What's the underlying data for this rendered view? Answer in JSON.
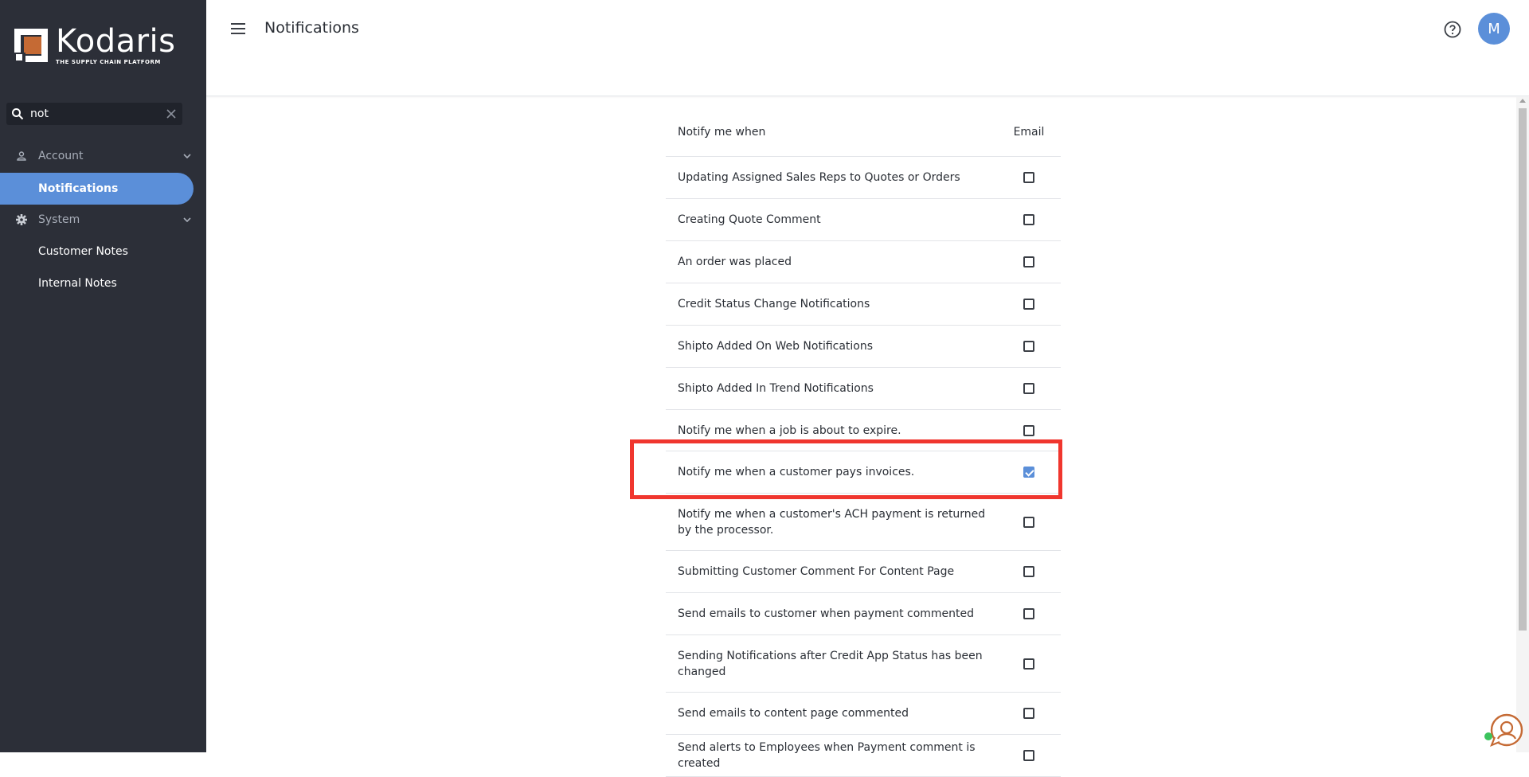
{
  "brand": {
    "name": "Kodaris",
    "tagline": "THE SUPPLY CHAIN PLATFORM",
    "accent": "#c56a34"
  },
  "search": {
    "value": "not",
    "placeholder": ""
  },
  "sidebar": {
    "groups": [
      {
        "label": "Account",
        "icon": "person-icon",
        "items": [
          {
            "label": "Notifications",
            "active": true
          }
        ]
      },
      {
        "label": "System",
        "icon": "gear-icon",
        "items": [
          {
            "label": "Customer Notes"
          },
          {
            "label": "Internal Notes"
          }
        ]
      }
    ]
  },
  "header": {
    "title": "Notifications",
    "avatar_initial": "M"
  },
  "table": {
    "col_event": "Notify me when",
    "col_email": "Email",
    "rows": [
      {
        "label": "Updating Assigned Sales Reps to Quotes or Orders",
        "email": false
      },
      {
        "label": "Creating Quote Comment",
        "email": false
      },
      {
        "label": "An order was placed",
        "email": false
      },
      {
        "label": "Credit Status Change Notifications",
        "email": false
      },
      {
        "label": "Shipto Added On Web Notifications",
        "email": false
      },
      {
        "label": "Shipto Added In Trend Notifications",
        "email": false
      },
      {
        "label": "Notify me when a job is about to expire.",
        "email": false
      },
      {
        "label": "Notify me when a customer pays invoices.",
        "email": true
      },
      {
        "label": "Notify me when a customer's ACH payment is returned by the processor.",
        "email": false
      },
      {
        "label": "Submitting Customer Comment For Content Page",
        "email": false
      },
      {
        "label": "Send emails to customer when payment commented",
        "email": false
      },
      {
        "label": "Sending Notifications after Credit App Status has been changed",
        "email": false
      },
      {
        "label": "Send emails to content page commented",
        "email": false
      },
      {
        "label": "Send alerts to Employees when Payment comment is created",
        "email": false
      }
    ]
  },
  "colors": {
    "sidebar_bg": "#2c2f38",
    "primary": "#5b8fd9",
    "highlight": "#f0362e"
  }
}
